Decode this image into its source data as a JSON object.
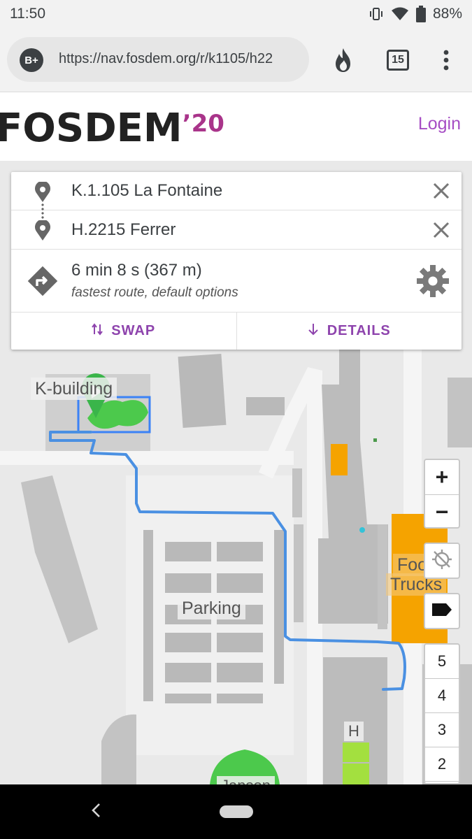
{
  "status_bar": {
    "time": "11:50",
    "battery": "88%",
    "icons": [
      "vibrate-icon",
      "wifi-icon",
      "battery-icon"
    ]
  },
  "browser": {
    "url": "https://nav.fosdem.org/r/k1105/h22",
    "site_badge": "B+",
    "tab_count": "15",
    "icons": [
      "site-badge-icon",
      "fire-icon",
      "tabs-icon",
      "more-vert-icon"
    ]
  },
  "header": {
    "logo": "FOSDEM",
    "logo_year": "’20",
    "login": "Login",
    "logo_year_color": "#a9348a",
    "link_color": "#a64dc4"
  },
  "route": {
    "from": "K.1.105 La Fontaine",
    "to": "H.2215 Ferrer",
    "duration": "6 min 8 s (367 m)",
    "options": "fastest route, default options",
    "swap_label": "SWAP",
    "details_label": "DETAILS",
    "accent_color": "#8e44ad",
    "route_color": "#4a90e2"
  },
  "map": {
    "labels": {
      "k_building": "K-building",
      "parking": "Parking",
      "food_trucks_1": "Food",
      "food_trucks_2": "Trucks",
      "h": "H",
      "janson": "Janson"
    },
    "zoom_in": "+",
    "zoom_out": "−",
    "floors": [
      "5",
      "4",
      "3",
      "2"
    ]
  }
}
